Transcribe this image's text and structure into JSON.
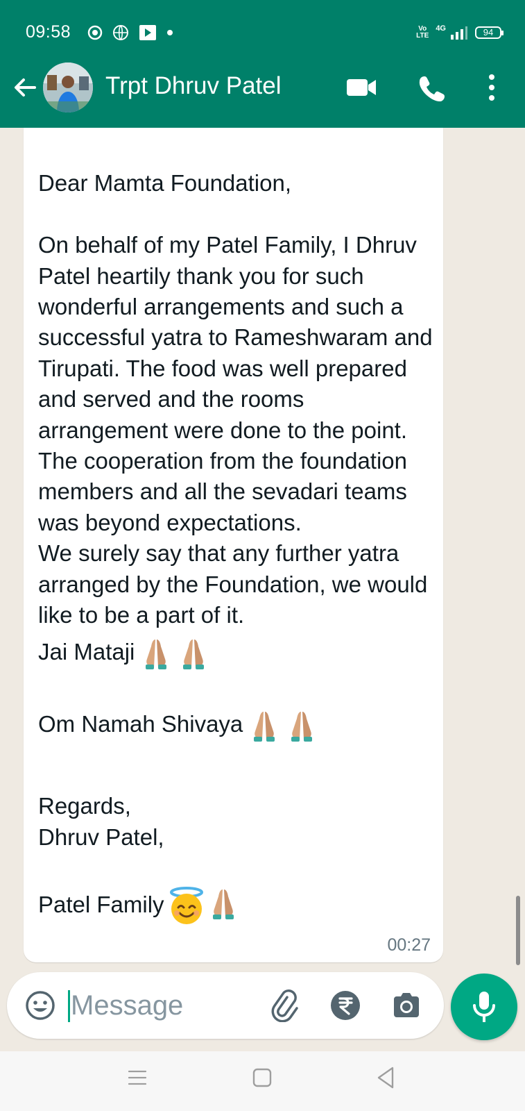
{
  "status_bar": {
    "time": "09:58",
    "network_label": "4G",
    "volte_label": "Vo LTE",
    "battery": "94"
  },
  "header": {
    "contact_name": "Trpt Dhruv Patel",
    "background_color": "#008069"
  },
  "message": {
    "text": "Dear Mamta Foundation,\n\nOn behalf of my Patel Family, I Dhruv Patel heartily thank you for such wonderful arrangements and such a successful yatra to Rameshwaram and Tirupati. The food was well prepared and served and the rooms arrangement were done to the point. The cooperation from the foundation members and all the sevadari teams was beyond expectations.\nWe surely say that any further yatra arranged by the Foundation, we would like to be a part of it.",
    "line_jai": "Jai Mataji",
    "line_om": "Om Namah Shivaya",
    "regards": "Regards,\nDhruv Patel,",
    "patel_family": "Patel Family",
    "time": "00:27",
    "emojis": [
      "folded-hands",
      "folded-hands",
      "smiling-face-with-halo"
    ]
  },
  "composer": {
    "placeholder": "Message"
  },
  "icons": {
    "back": "arrow-left-icon",
    "video": "video-camera-icon",
    "call": "phone-icon",
    "more": "more-vert-icon",
    "emoji": "emoji-icon",
    "attach": "paperclip-icon",
    "payment": "rupee-icon",
    "camera": "camera-icon",
    "mic": "mic-icon"
  },
  "colors": {
    "accent": "#00a884",
    "header": "#008069",
    "chat_bg": "#efeae2"
  }
}
